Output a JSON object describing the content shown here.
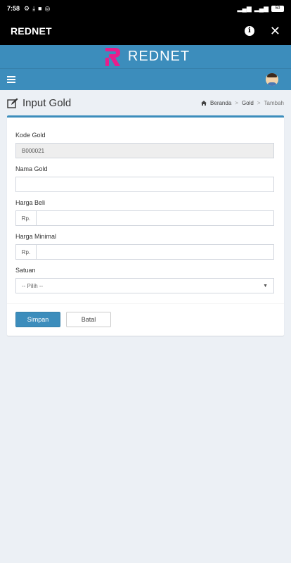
{
  "status_bar": {
    "time": "7:58",
    "battery": "50"
  },
  "app_bar": {
    "title": "REDNET"
  },
  "brand": {
    "name": "REDNET"
  },
  "page": {
    "title": "Input Gold"
  },
  "breadcrumb": {
    "home": "Beranda",
    "section": "Gold",
    "current": "Tambah",
    "separator": ">"
  },
  "form": {
    "kode_gold": {
      "label": "Kode Gold",
      "value": "B000021"
    },
    "nama_gold": {
      "label": "Nama Gold",
      "value": ""
    },
    "harga_beli": {
      "label": "Harga Beli",
      "prefix": "Rp.",
      "value": ""
    },
    "harga_minimal": {
      "label": "Harga Minimal",
      "prefix": "Rp.",
      "value": ""
    },
    "satuan": {
      "label": "Satuan",
      "selected": "-- Pilih --"
    }
  },
  "buttons": {
    "save": "Simpan",
    "cancel": "Batal"
  },
  "colors": {
    "primary": "#3c8dbc",
    "brand_accent": "#e91e8c",
    "background": "#ecf0f5"
  }
}
